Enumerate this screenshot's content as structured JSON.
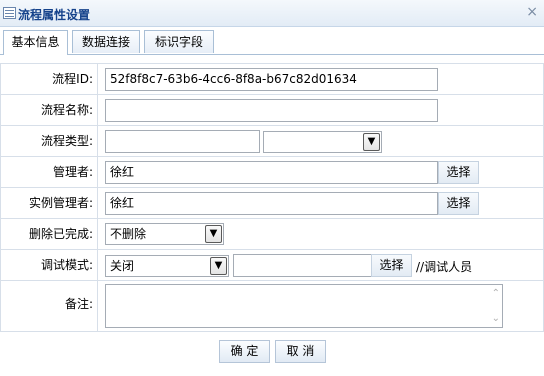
{
  "window": {
    "title": "流程属性设置",
    "close_symbol": "×"
  },
  "tabs": [
    {
      "label": "基本信息",
      "active": true
    },
    {
      "label": "数据连接",
      "active": false
    },
    {
      "label": "标识字段",
      "active": false
    }
  ],
  "form": {
    "flow_id": {
      "label": "流程ID:",
      "value": "52f8f8c7-63b6-4cc6-8f8a-b67c82d01634"
    },
    "flow_name": {
      "label": "流程名称:",
      "value": ""
    },
    "flow_type": {
      "label": "流程类型:",
      "value": "",
      "select_value": ""
    },
    "manager": {
      "label": "管理者:",
      "value": "徐红",
      "button": "选择"
    },
    "instance_manager": {
      "label": "实例管理者:",
      "value": "徐红",
      "button": "选择"
    },
    "delete_completed": {
      "label": "删除已完成:",
      "value": "不删除"
    },
    "debug_mode": {
      "label": "调试模式:",
      "value": "关闭",
      "debug_user": "",
      "button": "选择",
      "note": "//调试人员"
    },
    "remarks": {
      "label": "备注:",
      "value": ""
    }
  },
  "footer": {
    "ok": "确 定",
    "cancel": "取 消"
  },
  "icons": {
    "title": "list-icon",
    "dropdown": "chevron-down-icon",
    "close": "close-icon"
  }
}
